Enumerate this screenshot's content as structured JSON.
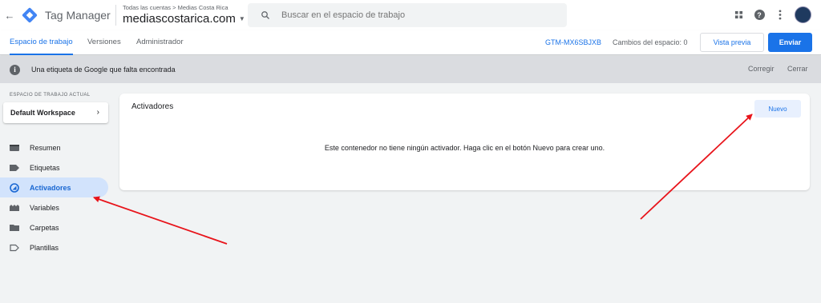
{
  "app": {
    "back_icon": "arrow-back-icon",
    "logo_icon": "tag-manager-logo",
    "product_name": "Tag Manager",
    "breadcrumb": "Todas las cuentas > Medias Costa Rica",
    "container_name": "mediascostarica.com",
    "search_placeholder": "Buscar en el espacio de trabajo"
  },
  "top_icons": [
    "apps-grid-icon",
    "help-icon",
    "more-vert-icon",
    "avatar"
  ],
  "tabs": [
    {
      "label": "Espacio de trabajo",
      "active": true
    },
    {
      "label": "Versiones",
      "active": false
    },
    {
      "label": "Administrador",
      "active": false
    }
  ],
  "toolbar": {
    "container_id": "GTM-MX6SBJXB",
    "workspace_changes": "Cambios del espacio: 0",
    "preview_label": "Vista previa",
    "submit_label": "Enviar"
  },
  "notice": {
    "text": "Una etiqueta de Google que falta encontrada",
    "fix_label": "Corregir",
    "close_label": "Cerrar"
  },
  "sidebar": {
    "workspace_label": "ESPACIO DE TRABAJO ACTUAL",
    "workspace_name": "Default Workspace",
    "items": [
      {
        "label": "Resumen",
        "icon": "overview-icon",
        "active": false
      },
      {
        "label": "Etiquetas",
        "icon": "tag-icon",
        "active": false
      },
      {
        "label": "Activadores",
        "icon": "trigger-icon",
        "active": true
      },
      {
        "label": "Variables",
        "icon": "variables-icon",
        "active": false
      },
      {
        "label": "Carpetas",
        "icon": "folder-icon",
        "active": false
      },
      {
        "label": "Plantillas",
        "icon": "template-icon",
        "active": false
      }
    ]
  },
  "main": {
    "title": "Activadores",
    "new_label": "Nuevo",
    "empty_message": "Este contenedor no tiene ningún activador. Haga clic en el botón Nuevo para crear uno."
  },
  "colors": {
    "accent": "#1a73e8",
    "active_nav_bg": "#d2e3fc",
    "annotation_arrow": "#e8141b"
  }
}
